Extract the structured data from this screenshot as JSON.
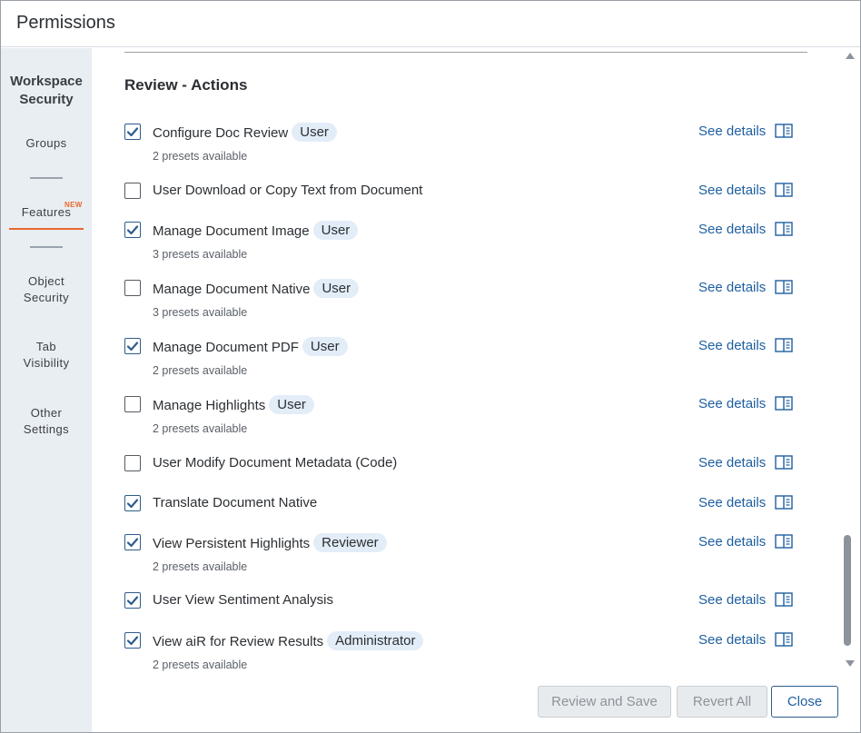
{
  "window": {
    "title": "Permissions"
  },
  "sidebar": {
    "heading": "Workspace Security",
    "items": [
      {
        "label": "Groups"
      },
      {
        "label": "Features",
        "badge": "NEW",
        "active": true
      },
      {
        "label": "Object Security"
      },
      {
        "label": "Tab Visibility"
      },
      {
        "label": "Other Settings"
      }
    ]
  },
  "section": {
    "title": "Review - Actions"
  },
  "details_label": "See details",
  "permissions": [
    {
      "label": "Configure Doc Review",
      "checked": true,
      "pill": "User",
      "presets": "2 presets available"
    },
    {
      "label": "User Download or Copy Text from Document",
      "checked": false,
      "pill": "",
      "presets": ""
    },
    {
      "label": "Manage Document Image",
      "checked": true,
      "pill": "User",
      "presets": "3 presets available"
    },
    {
      "label": "Manage Document Native",
      "checked": false,
      "pill": "User",
      "presets": "3 presets available"
    },
    {
      "label": "Manage Document PDF",
      "checked": true,
      "pill": "User",
      "presets": "2 presets available"
    },
    {
      "label": "Manage Highlights",
      "checked": false,
      "pill": "User",
      "presets": "2 presets available"
    },
    {
      "label": "User Modify Document Metadata (Code)",
      "checked": false,
      "pill": "",
      "presets": ""
    },
    {
      "label": "Translate Document Native",
      "checked": true,
      "pill": "",
      "presets": ""
    },
    {
      "label": "View Persistent Highlights",
      "checked": true,
      "pill": "Reviewer",
      "presets": "2 presets available"
    },
    {
      "label": "User View Sentiment Analysis",
      "checked": true,
      "pill": "",
      "presets": ""
    },
    {
      "label": "View aiR for Review Results",
      "checked": true,
      "pill": "Administrator",
      "presets": "2 presets available"
    }
  ],
  "footer": {
    "review_save": "Review and Save",
    "revert_all": "Revert All",
    "close": "Close"
  },
  "colors": {
    "accent": "#1f5fa0",
    "active_tab": "#e8692e",
    "pill_bg": "#e3edf8",
    "sidebar_bg": "#e9eef3"
  }
}
